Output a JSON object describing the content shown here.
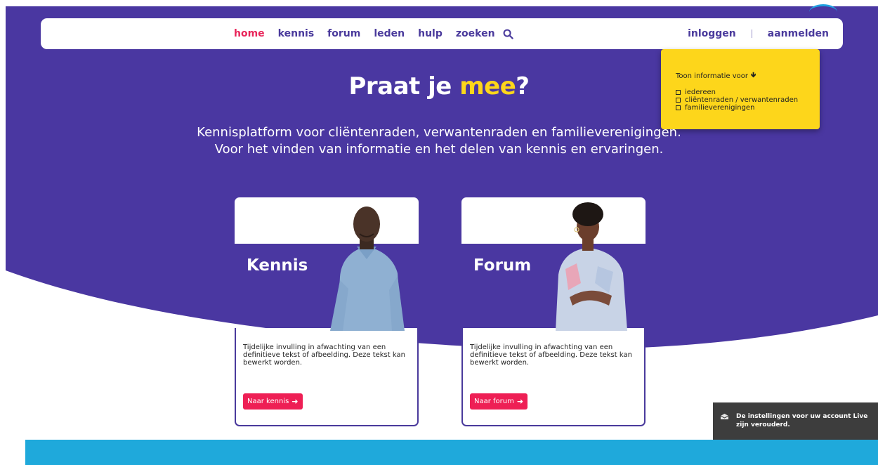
{
  "colors": {
    "hero_purple": "#4a37a1",
    "accent_yellow": "#fdd61b",
    "active_red": "#e8255a",
    "button_pink": "#ee1f55",
    "band_blue": "#1fa9db"
  },
  "nav": {
    "links": [
      "home",
      "kennis",
      "forum",
      "leden",
      "hulp",
      "zoeken"
    ],
    "active": "home",
    "search_icon": "search-icon",
    "login": "inloggen",
    "separator": "|",
    "register": "aanmelden"
  },
  "info_popup": {
    "title": "Toon informatie voor",
    "title_icon": "arrow-down-icon",
    "options": [
      "iedereen",
      "cliëntenraden / verwantenraden",
      "familieverenigingen"
    ]
  },
  "hero": {
    "title_main": "Praat je",
    "title_accent": "mee",
    "title_end": "?",
    "subtitle_line1": "Kennisplatform voor cliëntenraden, verwantenraden en familieverenigingen.",
    "subtitle_line2": "Voor het vinden van informatie en het delen van kennis en ervaringen."
  },
  "cards": [
    {
      "title": "Kennis",
      "text": "Tijdelijke invulling in afwachting van een definitieve tekst of afbeelding. Deze tekst kan bewerkt worden.",
      "button": "Naar kennis"
    },
    {
      "title": "Forum",
      "text": "Tijdelijke invulling in afwachting van een definitieve tekst of afbeelding. Deze tekst kan bewerkt worden.",
      "button": "Naar forum"
    }
  ],
  "toast": {
    "icon": "envelope-icon",
    "text": "De instellingen voor uw account Live zijn verouderd."
  }
}
